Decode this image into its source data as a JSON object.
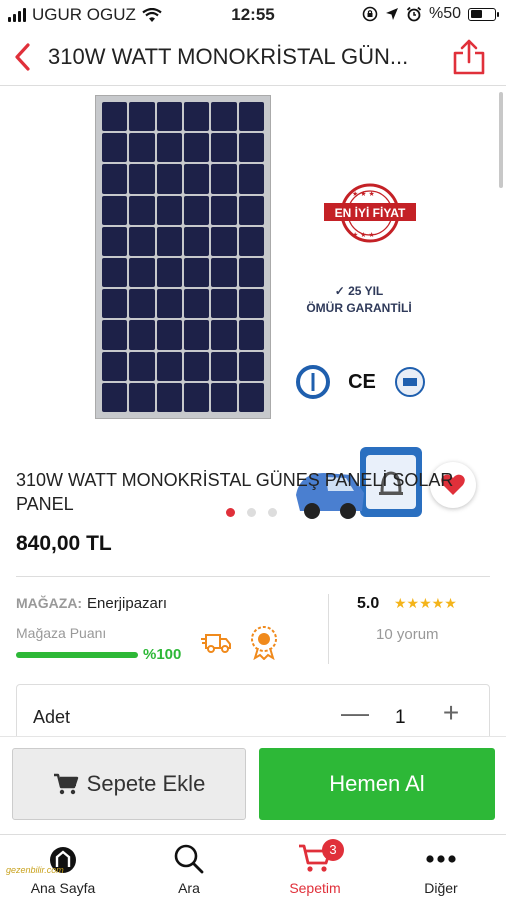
{
  "status_bar": {
    "carrier": "UGUR OGUZ",
    "time": "12:55",
    "battery": "%50"
  },
  "header": {
    "title": "310W WATT MONOKRİSTAL GÜN..."
  },
  "gallery": {
    "badge_text": "EN İYİ FİYAT",
    "warranty_line1": "✓ 25 YIL",
    "warranty_line2": "ÖMÜR GARANTİLİ",
    "cert_ce": "CE",
    "active_slide": 1,
    "total_slides": 3
  },
  "product": {
    "name": "310W WATT MONOKRİSTAL GÜNEŞ PANELİ SOLAR PANEL",
    "price": "840,00 TL"
  },
  "store": {
    "label": "MAĞAZA:",
    "name": "Enerjipazarı",
    "rating_label": "Mağaza Puanı",
    "rating_pct": "%100",
    "rating_value": 100,
    "score": "5.0",
    "stars": "★★★★★",
    "reviews": "10 yorum"
  },
  "quantity": {
    "label": "Adet",
    "value": "1",
    "minus": "—",
    "plus": "+"
  },
  "actions": {
    "add_to_cart": "Sepete Ekle",
    "buy_now": "Hemen Al"
  },
  "tabs": [
    {
      "label": "Ana Sayfa",
      "icon": "home-icon"
    },
    {
      "label": "Ara",
      "icon": "search-icon"
    },
    {
      "label": "Sepetim",
      "icon": "cart-icon",
      "badge": "3"
    },
    {
      "label": "Diğer",
      "icon": "more-icon"
    }
  ],
  "watermark": "gezenbilir.com",
  "colors": {
    "accent": "#e0303a",
    "buy": "#2db837",
    "star": "#f4b41a"
  }
}
